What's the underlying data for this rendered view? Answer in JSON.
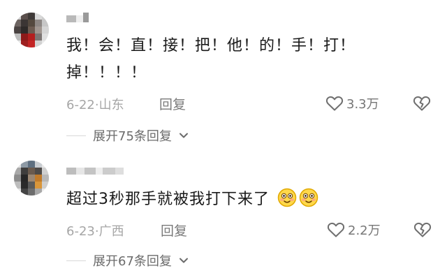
{
  "comments": [
    {
      "text_line1": "我！会！直！接！把！他！的！手！打！",
      "text_line2": "掉！！！！",
      "date": "6-22",
      "separator": "·",
      "location": "山东",
      "reply_label": "回复",
      "likes": "3.3万",
      "expand_label": "展开75条回复",
      "icons": [
        "heart-outline-icon",
        "broken-heart-icon",
        "chevron-down-icon"
      ]
    },
    {
      "text": "超过3秒那手就被我打下来了",
      "date": "6-23",
      "separator": "·",
      "location": "广西",
      "reply_label": "回复",
      "likes": "2.2万",
      "expand_label": "展开67条回复",
      "icons": [
        "smile-emoji-icon",
        "smile-emoji-icon",
        "heart-outline-icon",
        "broken-heart-icon",
        "chevron-down-icon"
      ]
    }
  ]
}
